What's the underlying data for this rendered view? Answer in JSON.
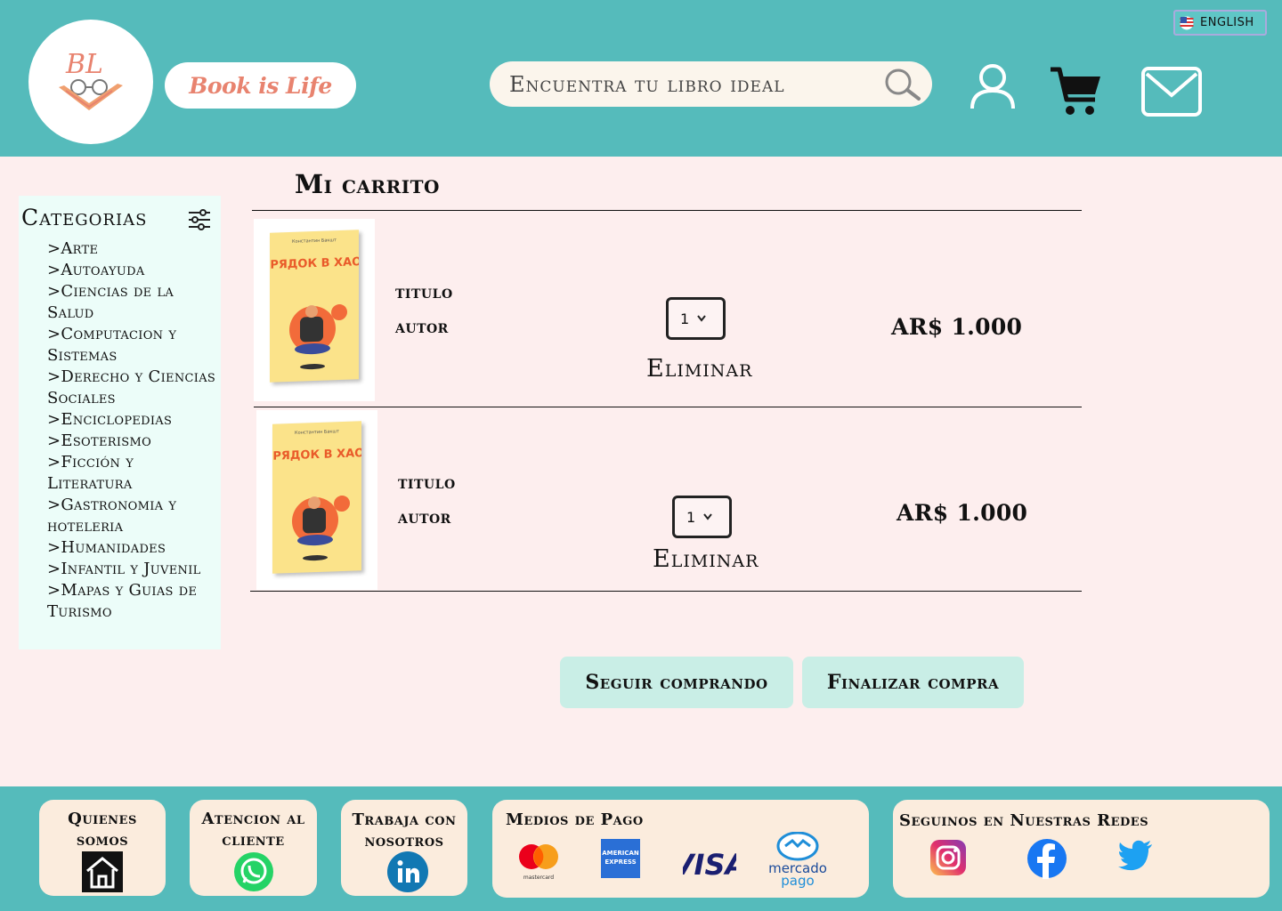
{
  "header": {
    "logo_text": "BL",
    "brand": "Book is Life",
    "search_placeholder": "Encuentra tu libro ideal",
    "language": "ENGLISH"
  },
  "sidebar": {
    "title": "Categorias",
    "categories": [
      ">Arte",
      ">Autoayuda",
      ">Ciencias de la Salud",
      ">Computacion y Sistemas",
      ">Derecho y Ciencias Sociales",
      ">Enciclopedias",
      ">Esoterismo",
      ">Ficción y Literatura",
      ">Gastronomia y hoteleria",
      ">Humanidades",
      ">Infantil y Juvenil",
      ">Mapas y Guias de Turismo"
    ]
  },
  "cart": {
    "title": "Mi carrito",
    "items": [
      {
        "title": "titulo",
        "author": "autor",
        "quantity": "1",
        "remove_label": "Eliminar",
        "price": "AR$ 1.000",
        "cover_title": "ПОРЯДОК В ХАОСЕ"
      },
      {
        "title": "titulo",
        "author": "autor",
        "quantity": "1",
        "remove_label": "Eliminar",
        "price": "AR$ 1.000",
        "cover_title": "ПОРЯДОК В ХАОСЕ"
      }
    ],
    "continue_label": "Seguir comprando",
    "checkout_label": "Finalizar compra"
  },
  "footer": {
    "about": "Quienes somos",
    "support": "Atencion al cliente",
    "jobs": "Trabaja con nosotros",
    "payments_title": "Medios de Pago",
    "payments": [
      "mastercard",
      "AMERICAN EXPRESS",
      "VISA",
      "mercado pago"
    ],
    "social_title": "Seguinos en Nuestras Redes"
  },
  "colors": {
    "header_bg": "#55bbbb",
    "page_bg": "#fdeeee",
    "accent": "#e8836f",
    "button_bg": "#c9eee6",
    "card_bg": "#fbecdd"
  }
}
